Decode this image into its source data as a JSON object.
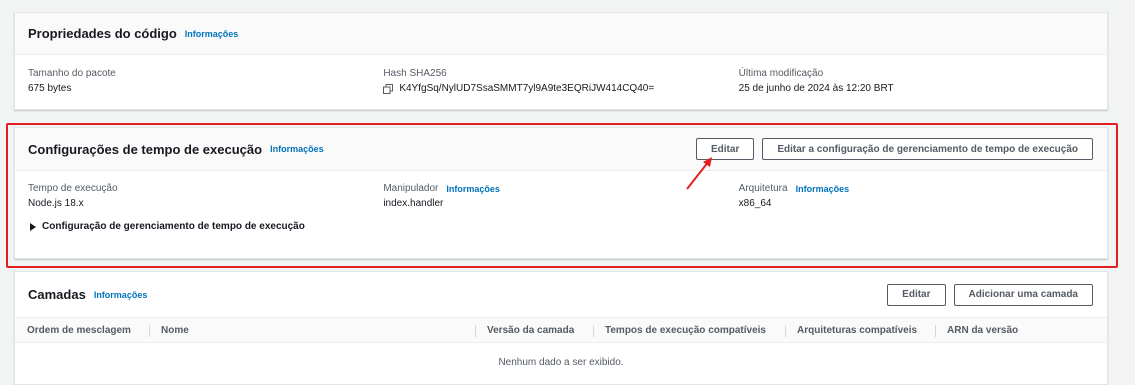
{
  "code_properties": {
    "title": "Propriedades do código",
    "info": "Informações",
    "package_size_label": "Tamanho do pacote",
    "package_size_value": "675 bytes",
    "hash_label": "Hash SHA256",
    "hash_value": "K4YfgSq/NylUD7SsaSMMT7yl9A9te3EQRiJW414CQ40=",
    "modified_label": "Última modificação",
    "modified_value": "25 de junho de 2024 às 12:20 BRT"
  },
  "runtime_settings": {
    "title": "Configurações de tempo de execução",
    "info": "Informações",
    "edit_button": "Editar",
    "edit_management_button": "Editar a configuração de gerenciamento de tempo de execução",
    "runtime_label": "Tempo de execução",
    "runtime_value": "Node.js 18.x",
    "handler_label": "Manipulador",
    "handler_info": "Informações",
    "handler_value": "index.handler",
    "arch_label": "Arquitetura",
    "arch_info": "Informações",
    "arch_value": "x86_64",
    "expand_label": "Configuração de gerenciamento de tempo de execução"
  },
  "layers": {
    "title": "Camadas",
    "info": "Informações",
    "edit_button": "Editar",
    "add_button": "Adicionar uma camada",
    "columns": [
      "Ordem de mesclagem",
      "Nome",
      "Versão da camada",
      "Tempos de execução compatíveis",
      "Arquiteturas compatíveis",
      "ARN da versão"
    ],
    "empty_message": "Nenhum dado a ser exibido."
  },
  "colors": {
    "highlight": "#e02020",
    "link": "#0073bb"
  },
  "icons": {
    "copy": "copy-icon",
    "caret": "caret-right-icon",
    "arrow": "red-arrow-annotation"
  }
}
